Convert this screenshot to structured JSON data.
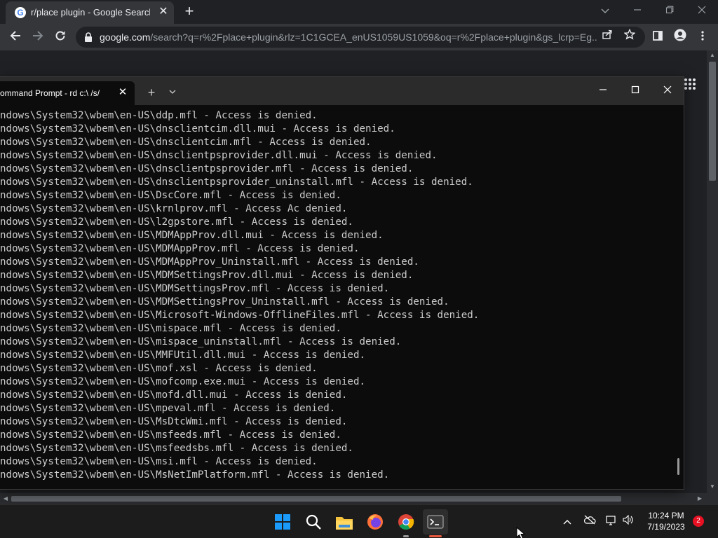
{
  "browser": {
    "tab_title": "r/place plugin - Google Search",
    "tab_favicon": "G",
    "close_glyph": "✕",
    "newtab_glyph": "+",
    "url_host": "google.com",
    "url_path": "/search?q=r%2Fplace+plugin&rlz=1C1GCEA_enUS1059US1059&oq=r%2Fplace+plugin&gs_lcrp=Eg...",
    "icons": [
      "back-icon",
      "forward-icon",
      "reload-icon",
      "lock-icon",
      "share-icon",
      "star-icon",
      "side-panel-icon",
      "profile-icon",
      "menu-icon",
      "apps-grid-icon"
    ]
  },
  "terminal": {
    "tab_title": "ommand Prompt - rd  c:\\ /s/",
    "lines": [
      "ndows\\System32\\wbem\\en-US\\ddp.mfl - Access is denied.",
      "ndows\\System32\\wbem\\en-US\\dnsclientcim.dll.mui - Access is denied.",
      "ndows\\System32\\wbem\\en-US\\dnsclientcim.mfl - Access is denied.",
      "ndows\\System32\\wbem\\en-US\\dnsclientpsprovider.dll.mui - Access is denied.",
      "ndows\\System32\\wbem\\en-US\\dnsclientpsprovider.mfl - Access is denied.",
      "ndows\\System32\\wbem\\en-US\\dnsclientpsprovider_uninstall.mfl - Access is denied.",
      "ndows\\System32\\wbem\\en-US\\DscCore.mfl - Access is denied.",
      "ndows\\System32\\wbem\\en-US\\krnlprov.mfl - Access Ac denied.",
      "ndows\\System32\\wbem\\en-US\\l2gpstore.mfl - Access is denied.",
      "ndows\\System32\\wbem\\en-US\\MDMAppProv.dll.mui - Access is denied.",
      "ndows\\System32\\wbem\\en-US\\MDMAppProv.mfl - Access is denied.",
      "ndows\\System32\\wbem\\en-US\\MDMAppProv_Uninstall.mfl - Access is denied.",
      "ndows\\System32\\wbem\\en-US\\MDMSettingsProv.dll.mui - Access is denied.",
      "ndows\\System32\\wbem\\en-US\\MDMSettingsProv.mfl - Access is denied.",
      "ndows\\System32\\wbem\\en-US\\MDMSettingsProv_Uninstall.mfl - Access is denied.",
      "ndows\\System32\\wbem\\en-US\\Microsoft-Windows-OfflineFiles.mfl - Access is denied.",
      "ndows\\System32\\wbem\\en-US\\mispace.mfl - Access is denied.",
      "ndows\\System32\\wbem\\en-US\\mispace_uninstall.mfl - Access is denied.",
      "ndows\\System32\\wbem\\en-US\\MMFUtil.dll.mui - Access is denied.",
      "ndows\\System32\\wbem\\en-US\\mof.xsl - Access is denied.",
      "ndows\\System32\\wbem\\en-US\\mofcomp.exe.mui - Access is denied.",
      "ndows\\System32\\wbem\\en-US\\mofd.dll.mui - Access is denied.",
      "ndows\\System32\\wbem\\en-US\\mpeval.mfl - Access is denied.",
      "ndows\\System32\\wbem\\en-US\\MsDtcWmi.mfl - Access is denied.",
      "ndows\\System32\\wbem\\en-US\\msfeeds.mfl - Access is denied.",
      "ndows\\System32\\wbem\\en-US\\msfeedsbs.mfl - Access is denied.",
      "ndows\\System32\\wbem\\en-US\\msi.mfl - Access is denied.",
      "ndows\\System32\\wbem\\en-US\\MsNetImPlatform.mfl - Access is denied."
    ]
  },
  "taskbar": {
    "apps": [
      {
        "name": "start-icon"
      },
      {
        "name": "search-icon"
      },
      {
        "name": "file-explorer-icon"
      },
      {
        "name": "firefox-icon"
      },
      {
        "name": "chrome-icon"
      },
      {
        "name": "terminal-icon"
      }
    ],
    "time": "10:24 PM",
    "date": "7/19/2023",
    "notification_count": "2",
    "colors": {
      "start": "#1a9bfc",
      "folder": "#f4c23d",
      "accent_indicator": "#e85a3f"
    }
  }
}
